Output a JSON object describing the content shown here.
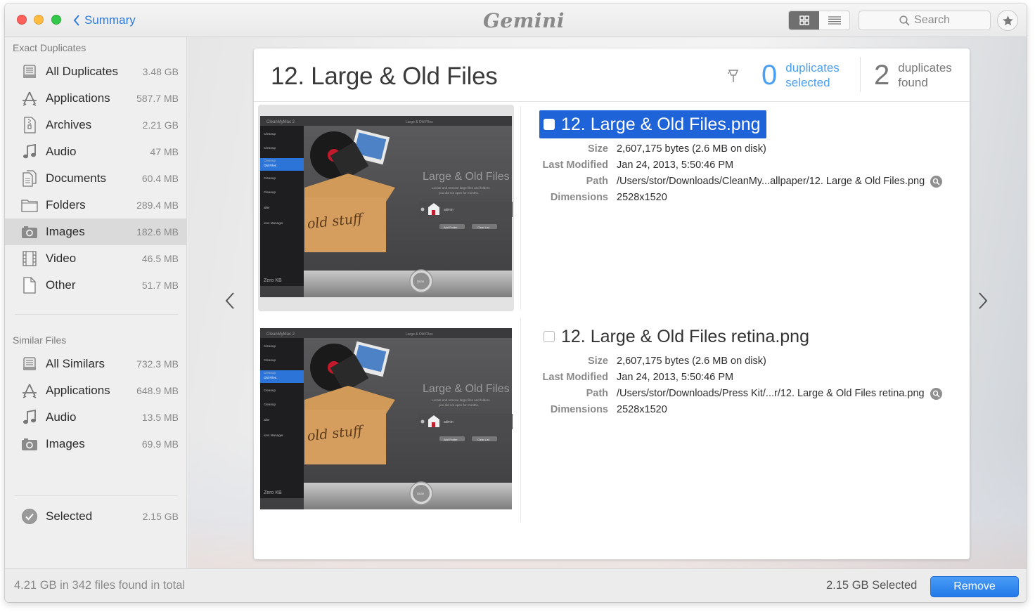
{
  "titlebar": {
    "back_label": "Summary",
    "app_name": "Gemini",
    "search_placeholder": "Search"
  },
  "sidebar": {
    "exact_title": "Exact Duplicates",
    "exact_items": [
      {
        "label": "All Duplicates",
        "size": "3.48 GB",
        "icon": "all-duplicates-icon"
      },
      {
        "label": "Applications",
        "size": "587.7 MB",
        "icon": "applications-icon"
      },
      {
        "label": "Archives",
        "size": "2.21 GB",
        "icon": "archive-icon"
      },
      {
        "label": "Audio",
        "size": "47 MB",
        "icon": "music-note-icon"
      },
      {
        "label": "Documents",
        "size": "60.4 MB",
        "icon": "documents-icon"
      },
      {
        "label": "Folders",
        "size": "289.4 MB",
        "icon": "folder-icon"
      },
      {
        "label": "Images",
        "size": "182.6 MB",
        "icon": "camera-icon"
      },
      {
        "label": "Video",
        "size": "46.5 MB",
        "icon": "film-icon"
      },
      {
        "label": "Other",
        "size": "51.7 MB",
        "icon": "file-icon"
      }
    ],
    "similar_title": "Similar Files",
    "similar_items": [
      {
        "label": "All Similars",
        "size": "732.3 MB",
        "icon": "all-similars-icon"
      },
      {
        "label": "Applications",
        "size": "648.9 MB",
        "icon": "applications-icon"
      },
      {
        "label": "Audio",
        "size": "13.5 MB",
        "icon": "music-note-icon"
      },
      {
        "label": "Images",
        "size": "69.9 MB",
        "icon": "camera-icon"
      }
    ],
    "selected_item": {
      "label": "Selected",
      "size": "2.15 GB",
      "icon": "checkmark-circle-icon"
    }
  },
  "card": {
    "title": "12. Large & Old Files",
    "selected_count": "0",
    "selected_label_1": "duplicates",
    "selected_label_2": "selected",
    "found_count": "2",
    "found_label_1": "duplicates",
    "found_label_2": "found",
    "files": [
      {
        "name": "12. Large & Old Files.png",
        "checked": false,
        "highlighted": true,
        "size_key": "Size",
        "size": "2,607,175 bytes (2.6 MB on disk)",
        "modified_key": "Last Modified",
        "modified": "Jan 24, 2013, 5:50:46 PM",
        "path_key": "Path",
        "path": "/Users/stor/Downloads/CleanMy...allpaper/12. Large & Old Files.png",
        "dim_key": "Dimensions",
        "dimensions": "2528x1520",
        "thumb": {
          "app_title": "CleanMyMac 2",
          "window_title": "Large & Old Files",
          "heading": "Large & Old Files",
          "sub1": "Locate and remove large files and folders",
          "sub2": "you did not open for months.",
          "user": "admin",
          "btn1": "Add Folder",
          "btn2": "Clear List",
          "scan": "Scan",
          "box_text": "old stuff",
          "footer": "Zero KB",
          "menu_items": [
            "Cleanup",
            "Cleanup",
            "Cleanup",
            "Old Files",
            "Cleanup",
            "Cleanup",
            "aller",
            "ions Manager"
          ]
        }
      },
      {
        "name": "12. Large & Old Files retina.png",
        "checked": false,
        "highlighted": false,
        "size_key": "Size",
        "size": "2,607,175 bytes (2.6 MB on disk)",
        "modified_key": "Last Modified",
        "modified": "Jan 24, 2013, 5:50:46 PM",
        "path_key": "Path",
        "path": "/Users/stor/Downloads/Press Kit/...r/12. Large & Old Files retina.png",
        "dim_key": "Dimensions",
        "dimensions": "2528x1520",
        "thumb": {
          "app_title": "CleanMyMac 2",
          "window_title": "Large & Old Files",
          "heading": "Large & Old Files",
          "sub1": "Locate and remove large files and folders",
          "sub2": "you did not open for months.",
          "user": "admin",
          "btn1": "Add Folder",
          "btn2": "Clear List",
          "scan": "Scan",
          "box_text": "old stuff",
          "footer": "Zero KB",
          "menu_items": [
            "Cleanup",
            "Cleanup",
            "Cleanup",
            "Old Files",
            "Cleanup",
            "Cleanup",
            "aller",
            "ions Manager"
          ]
        }
      }
    ]
  },
  "footer": {
    "total_text": "4.21 GB in 342 files found in total",
    "selected_text": "2.15 GB Selected",
    "remove_label": "Remove"
  },
  "colors": {
    "accent": "#2f7bdc",
    "highlight": "#1f63d8",
    "remove_button": "#237ae8"
  }
}
